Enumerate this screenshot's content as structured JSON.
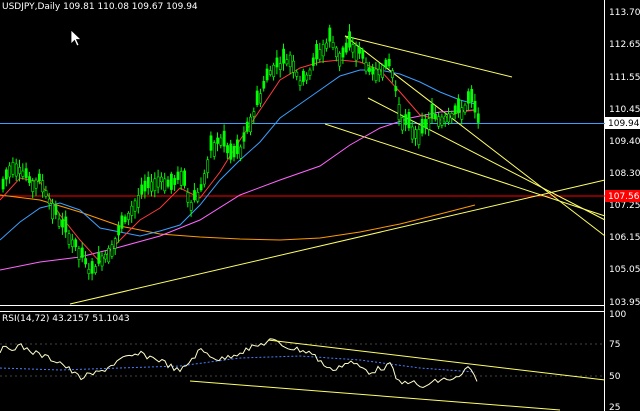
{
  "main_chart": {
    "header": "USDJPY,Daily  109.81 110.08 109.67 109.94",
    "price_axis": [
      "113.70",
      "112.65",
      "111.55",
      "110.45",
      "109.40",
      "108.30",
      "107.25",
      "106.15",
      "105.05",
      "103.95"
    ],
    "current_price_label": "109.94",
    "level_label": "107.56"
  },
  "rsi_panel": {
    "header": "RSI(14,72)  43.2157  51.1043",
    "axis": [
      "100",
      "75",
      "50",
      "25"
    ]
  },
  "colors": {
    "background": "#000000",
    "axis_line": "#ffffff",
    "bull_candle": "#00ff00",
    "bear_candle": "#00ff00",
    "ma_fast": "#ff3b3b",
    "ma_mid": "#3aa0ff",
    "ma_slow": "#ff66ff",
    "ma_long": "#ff9900",
    "trendline": "#ffff66",
    "level_line": "#ff0000",
    "current_line": "#3aa0ff",
    "rsi_line": "#ffffcc",
    "rsi_signal": "#4a7dff"
  },
  "icons": {
    "cursor": "mouse-pointer-icon"
  }
}
